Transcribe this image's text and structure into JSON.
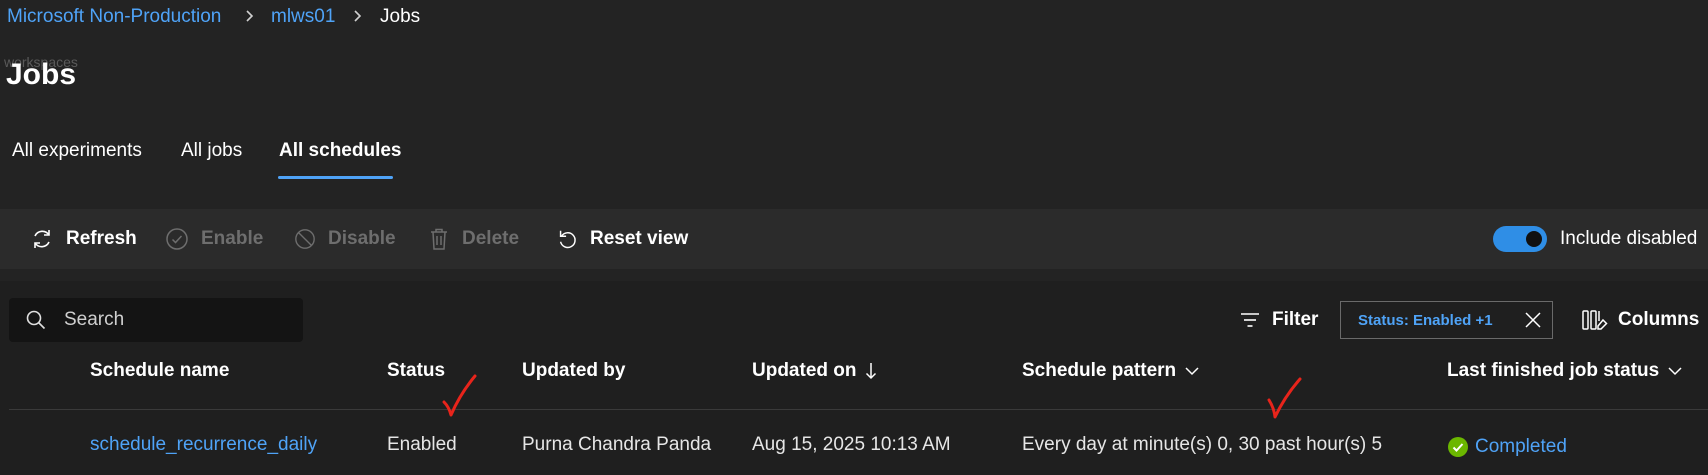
{
  "breadcrumb": {
    "items": [
      "Microsoft Non-Production",
      "mlws01",
      "Jobs"
    ]
  },
  "ghost_text": "workspaces",
  "page": {
    "title": "Jobs"
  },
  "tabs": [
    {
      "label": "All experiments",
      "active": false
    },
    {
      "label": "All jobs",
      "active": false
    },
    {
      "label": "All schedules",
      "active": true
    }
  ],
  "toolbar": {
    "refresh": "Refresh",
    "enable": "Enable",
    "disable": "Disable",
    "delete": "Delete",
    "reset_view": "Reset view",
    "include_disabled": {
      "label": "Include disabled",
      "on": true
    }
  },
  "grid": {
    "search_placeholder": "Search",
    "filter_label": "Filter",
    "filter_chip": "Status: Enabled +1",
    "columns_label": "Columns",
    "headers": [
      "Schedule name",
      "Status",
      "Updated by",
      "Updated on",
      "Schedule pattern",
      "Last finished job status"
    ],
    "rows": [
      {
        "schedule_name": "schedule_recurrence_daily",
        "status": "Enabled",
        "updated_by": "Purna Chandra Panda",
        "updated_on": "Aug 15, 2025 10:13 AM",
        "schedule_pattern": "Every day at minute(s) 0, 30 past hour(s) 5",
        "last_job_status": "Completed"
      }
    ]
  },
  "colors": {
    "accent": "#4fa3f7",
    "toggle": "#2f8ee6",
    "success": "#6bb700",
    "annotation": "#e8241b"
  }
}
